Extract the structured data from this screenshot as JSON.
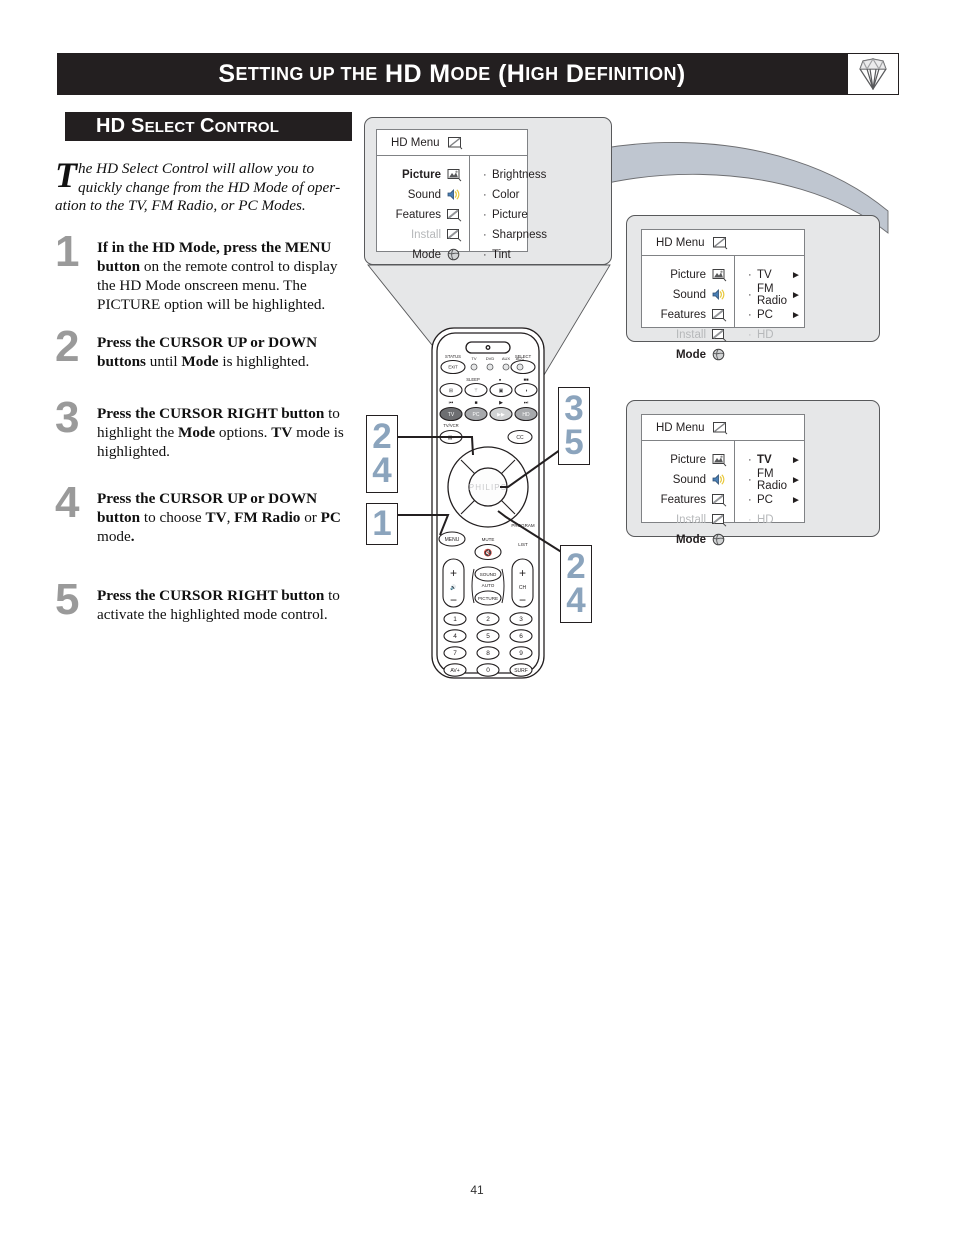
{
  "header": {
    "title_parts": [
      {
        "t": "S",
        "cap": true
      },
      {
        "t": "ETTING",
        "cap": false
      },
      {
        "t": " ",
        "cap": false
      },
      {
        "t": "UP",
        "cap": false
      },
      {
        "t": " ",
        "cap": false
      },
      {
        "t": "THE",
        "cap": false
      }
    ],
    "title": "SETTING UP THE HD MODE (HIGH DEFINITION)",
    "logo_icon": "diamond-gem-icon"
  },
  "section": {
    "title": "HD SELECT CONTROL"
  },
  "intro": {
    "dropcap": "T",
    "text": "he HD Select Control will allow you to quickly change from the HD Mode of operation to the TV, FM Radio, or PC Modes."
  },
  "steps": [
    {
      "number": "1",
      "html": "<b>If in the HD Mode, press the MENU button</b> on the remote control to display the HD Mode onscreen menu. The PICTURE option will be highlighted."
    },
    {
      "number": "2",
      "html": "<b>Press the CURSOR UP or DOWN buttons</b> until <b>Mode</b> is highlighted."
    },
    {
      "number": "3",
      "html": "<b>Press the CURSOR RIGHT button</b> to highlight the <b>Mode</b> options. <b>TV</b> mode is highlighted."
    },
    {
      "number": "4",
      "html": "<b>Press the CURSOR UP or DOWN button</b> to choose <b>TV</b>, <b>FM Radio</b> or <b>PC</b> mode<b>.</b>"
    },
    {
      "number": "5",
      "html": "<b>Press the CURSOR RIGHT button</b> to activate the highlighted mode control."
    }
  ],
  "osd_menus": [
    {
      "id": "menu-picture",
      "header_label": "HD Menu",
      "header_icon": "tv-screen-icon",
      "left_items": [
        {
          "label": "Picture",
          "icon": "picture-icon",
          "state": "bold"
        },
        {
          "label": "Sound",
          "icon": "sound-icon",
          "state": "normal"
        },
        {
          "label": "Features",
          "icon": "features-icon",
          "state": "normal"
        },
        {
          "label": "Install",
          "icon": "install-icon",
          "state": "dim"
        },
        {
          "label": "Mode",
          "icon": "mode-globe-icon",
          "state": "normal"
        }
      ],
      "right_items": [
        {
          "label": "Brightness",
          "state": "normal",
          "arrow": false
        },
        {
          "label": "Color",
          "state": "normal",
          "arrow": false
        },
        {
          "label": "Picture",
          "state": "normal",
          "arrow": false
        },
        {
          "label": "Sharpness",
          "state": "normal",
          "arrow": false
        },
        {
          "label": "Tint",
          "state": "normal",
          "arrow": false
        }
      ]
    },
    {
      "id": "menu-mode",
      "header_label": "HD Menu",
      "header_icon": "tv-screen-icon",
      "left_items": [
        {
          "label": "Picture",
          "icon": "picture-icon",
          "state": "normal"
        },
        {
          "label": "Sound",
          "icon": "sound-icon",
          "state": "normal"
        },
        {
          "label": "Features",
          "icon": "features-icon",
          "state": "normal"
        },
        {
          "label": "Install",
          "icon": "install-icon",
          "state": "dim"
        },
        {
          "label": "Mode",
          "icon": "mode-globe-icon",
          "state": "bold"
        }
      ],
      "right_items": [
        {
          "label": "TV",
          "state": "normal",
          "arrow": true
        },
        {
          "label": "FM Radio",
          "state": "normal",
          "arrow": true
        },
        {
          "label": "PC",
          "state": "normal",
          "arrow": true
        },
        {
          "label": "HD",
          "state": "dim",
          "arrow": false
        }
      ]
    },
    {
      "id": "menu-mode-tv-selected",
      "header_label": "HD Menu",
      "header_icon": "tv-screen-icon",
      "left_items": [
        {
          "label": "Picture",
          "icon": "picture-icon",
          "state": "normal"
        },
        {
          "label": "Sound",
          "icon": "sound-icon",
          "state": "normal"
        },
        {
          "label": "Features",
          "icon": "features-icon",
          "state": "normal"
        },
        {
          "label": "Install",
          "icon": "install-icon",
          "state": "dim"
        },
        {
          "label": "Mode",
          "icon": "mode-globe-icon",
          "state": "bold"
        }
      ],
      "right_items": [
        {
          "label": "TV",
          "state": "bold",
          "arrow": true
        },
        {
          "label": "FM Radio",
          "state": "normal",
          "arrow": true
        },
        {
          "label": "PC",
          "state": "normal",
          "arrow": true
        },
        {
          "label": "HD",
          "state": "dim",
          "arrow": false
        }
      ]
    }
  ],
  "callouts": [
    {
      "id": "callout-2-4-left",
      "lines": [
        "2",
        "4"
      ]
    },
    {
      "id": "callout-1",
      "lines": [
        "1"
      ]
    },
    {
      "id": "callout-3-5",
      "lines": [
        "3",
        "5"
      ]
    },
    {
      "id": "callout-2-4-right",
      "lines": [
        "2",
        "4"
      ]
    }
  ],
  "remote": {
    "brand": "PHILIPS",
    "labels": {
      "status": "STATUS",
      "exit": "EXIT",
      "select": "SELECT",
      "sleep": "SLEEP",
      "tvvcr": "TV/VCR",
      "menu": "MENU",
      "mute": "MUTE",
      "program": "PROGRAM",
      "ch": "CH",
      "sound": "SOUND",
      "auto": "AUTO",
      "picture": "PICTURE",
      "cc": "CC",
      "surf": "SURF",
      "av": "AV+"
    },
    "source_labels": [
      "TV",
      "DVD",
      "AUX",
      "ACC"
    ],
    "mode_row": [
      "TV",
      "PC",
      "HD"
    ],
    "keypad": [
      "1",
      "2",
      "3",
      "4",
      "5",
      "6",
      "7",
      "8",
      "9",
      "AV+",
      "0",
      "SURF"
    ]
  },
  "page": {
    "number": "41"
  },
  "colors": {
    "header_bg": "#231f20",
    "callout_number": "#8ba4bd",
    "step_number": "#9a9a9a",
    "osd_frame": "#e6e7e8",
    "osd_dim_text": "#b6b8ba",
    "arrow_fill": "#bfc6d0",
    "funnel_fill": "#e6e7e8"
  }
}
